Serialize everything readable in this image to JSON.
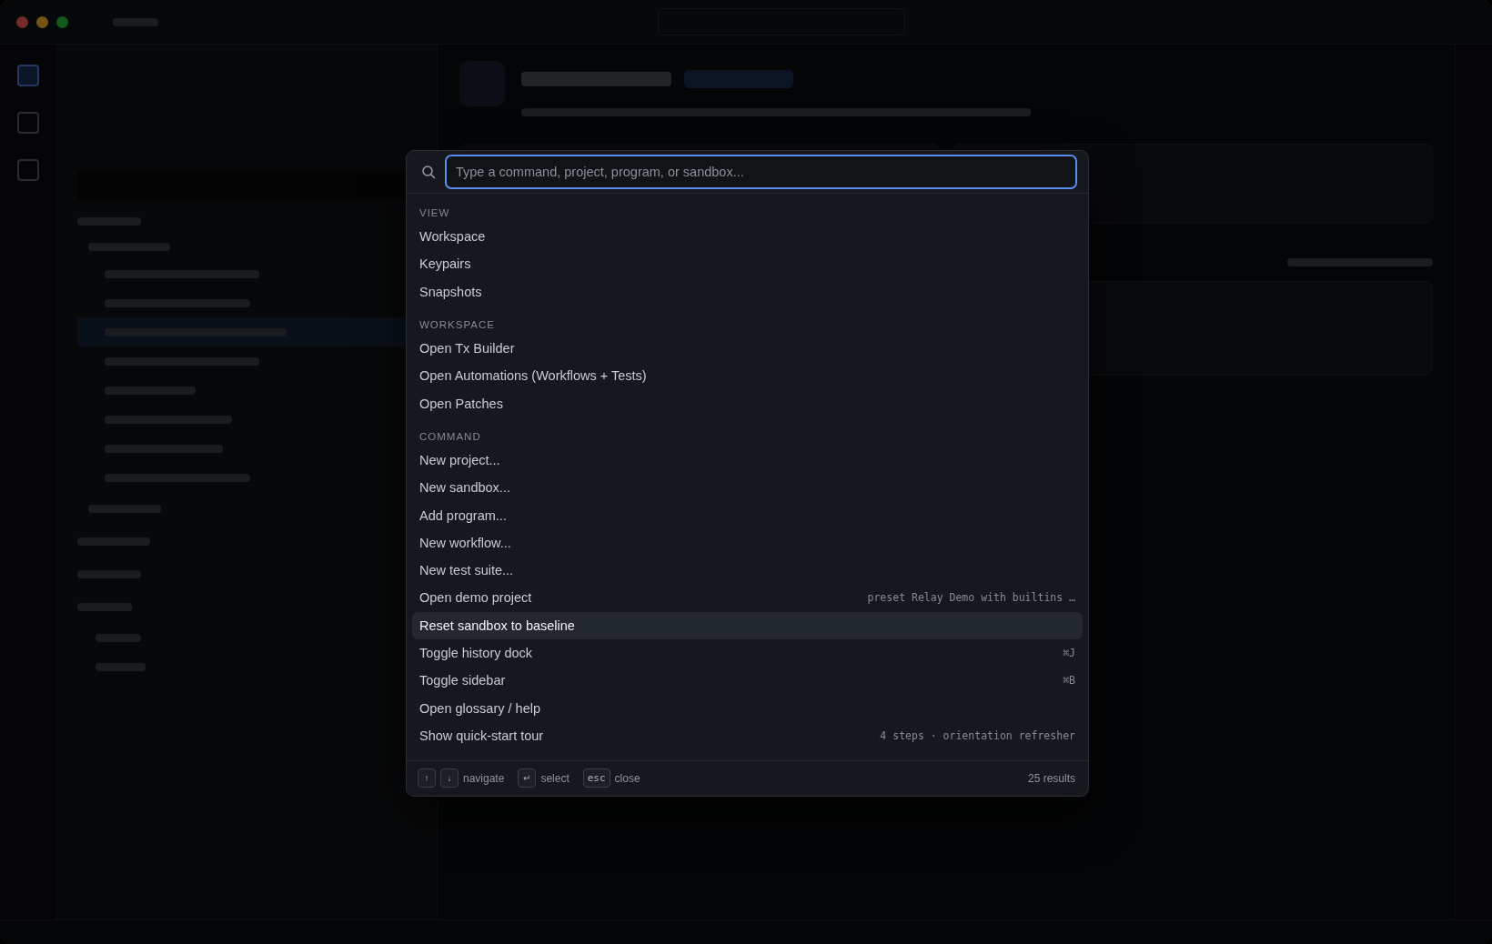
{
  "palette": {
    "placeholder": "Type a command, project, program, or sandbox...",
    "sections": [
      {
        "title": "VIEW",
        "items": [
          {
            "label": "Workspace",
            "selected": false
          },
          {
            "label": "Keypairs",
            "selected": false
          },
          {
            "label": "Snapshots",
            "selected": false
          }
        ]
      },
      {
        "title": "WORKSPACE",
        "items": [
          {
            "label": "Open Tx Builder",
            "selected": false
          },
          {
            "label": "Open Automations (Workflows + Tests)",
            "selected": false
          },
          {
            "label": "Open Patches",
            "selected": false
          }
        ]
      },
      {
        "title": "COMMAND",
        "items": [
          {
            "label": "New project...",
            "selected": false
          },
          {
            "label": "New sandbox...",
            "selected": false
          },
          {
            "label": "Add program...",
            "selected": false
          },
          {
            "label": "New workflow...",
            "selected": false
          },
          {
            "label": "New test suite...",
            "selected": false
          },
          {
            "label": "Open demo project",
            "hint": "preset Relay Demo with builtins …",
            "selected": false
          },
          {
            "label": "Reset sandbox to baseline",
            "selected": true
          },
          {
            "label": "Toggle history dock",
            "shortcut": "⌘J",
            "selected": false
          },
          {
            "label": "Toggle sidebar",
            "shortcut": "⌘B",
            "selected": false
          },
          {
            "label": "Open glossary / help",
            "selected": false
          },
          {
            "label": "Show quick-start tour",
            "hint": "4 steps · orientation refresher",
            "selected": false
          }
        ]
      }
    ],
    "footer": {
      "keys": [
        {
          "key": "↑"
        },
        {
          "key": "↓",
          "label": "navigate"
        },
        {
          "key": "↵",
          "label": "select"
        },
        {
          "key": "esc",
          "label": "close"
        }
      ],
      "count": "25 results"
    }
  }
}
